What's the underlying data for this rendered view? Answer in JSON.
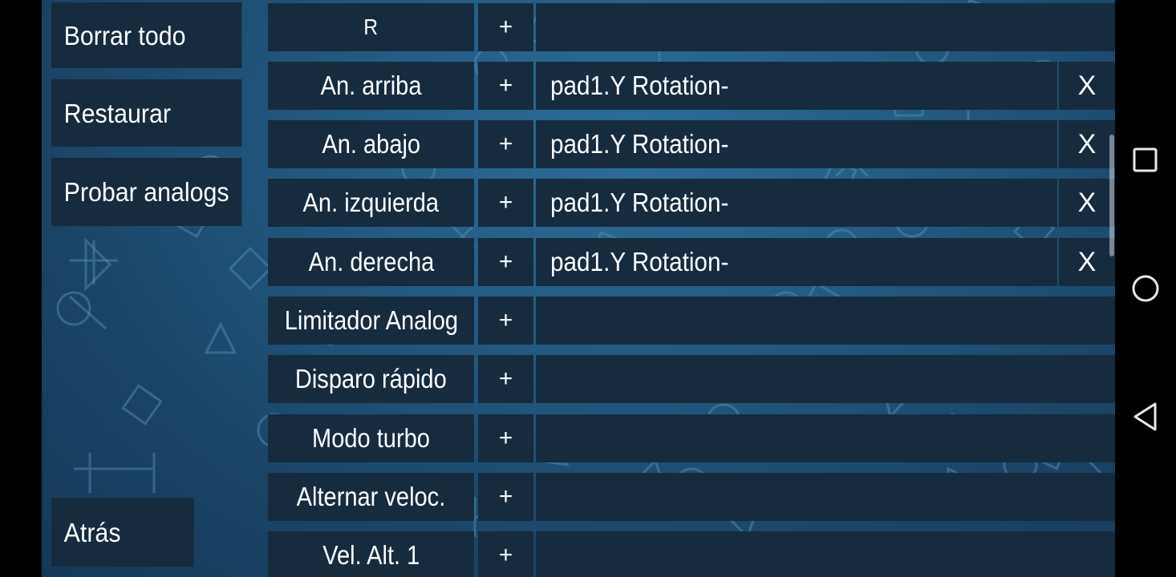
{
  "colors": {
    "background": "#1f5075",
    "cell": "#162b3e",
    "nav_bar": "#000000",
    "text": "#ffffff"
  },
  "sidebar": {
    "clear_all_label": "Borrar todo",
    "restore_label": "Restaurar",
    "test_analogs_label": "Probar analogs",
    "back_label": "Atrás"
  },
  "controls": {
    "add_symbol": "+",
    "remove_symbol": "X",
    "rows": [
      {
        "name": "R",
        "binding": ""
      },
      {
        "name": "An. arriba",
        "binding": "pad1.Y Rotation-"
      },
      {
        "name": "An. abajo",
        "binding": "pad1.Y Rotation-"
      },
      {
        "name": "An. izquierda",
        "binding": "pad1.Y Rotation-"
      },
      {
        "name": "An. derecha",
        "binding": "pad1.Y Rotation-"
      },
      {
        "name": "Limitador Analog",
        "binding": ""
      },
      {
        "name": "Disparo rápido",
        "binding": ""
      },
      {
        "name": "Modo turbo",
        "binding": ""
      },
      {
        "name": "Alternar veloc.",
        "binding": ""
      },
      {
        "name": "Vel. Alt. 1",
        "binding": ""
      }
    ]
  },
  "android_nav": {
    "recents_icon": "square-icon",
    "home_icon": "circle-icon",
    "back_icon": "triangle-back-icon"
  }
}
